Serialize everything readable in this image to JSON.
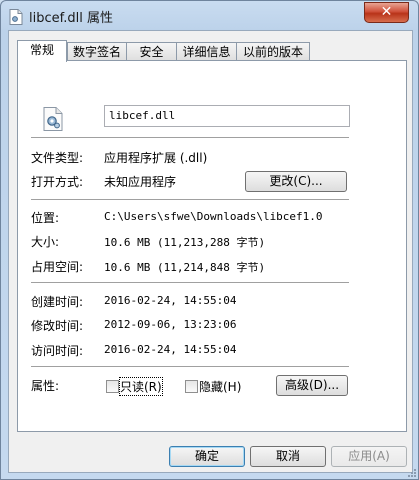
{
  "window": {
    "title": "libcef.dll 属性",
    "close_glyph": "✕"
  },
  "tabs": [
    {
      "label": "常规",
      "active": true
    },
    {
      "label": "数字签名",
      "active": false
    },
    {
      "label": "安全",
      "active": false
    },
    {
      "label": "详细信息",
      "active": false
    },
    {
      "label": "以前的版本",
      "active": false
    }
  ],
  "general": {
    "file_icon": "dll-file-gear-icon",
    "file_name": "libcef.dll",
    "file_type_label": "文件类型:",
    "file_type_value": "应用程序扩展 (.dll)",
    "opens_with_label": "打开方式:",
    "opens_with_value": "未知应用程序",
    "change_button": "更改(C)...",
    "location_label": "位置:",
    "location_value": "C:\\Users\\sfwe\\Downloads\\libcef1.0",
    "size_label": "大小:",
    "size_value": "10.6 MB (11,213,288 字节)",
    "size_on_disk_label": "占用空间:",
    "size_on_disk_value": "10.6 MB (11,214,848 字节)",
    "created_label": "创建时间:",
    "created_value": "2016-02-24, 14:55:04",
    "modified_label": "修改时间:",
    "modified_value": "2012-09-06, 13:23:06",
    "accessed_label": "访问时间:",
    "accessed_value": "2016-02-24, 14:55:04",
    "attributes_label": "属性:",
    "readonly_label": "只读(R)",
    "hidden_label": "隐藏(H)",
    "advanced_button": "高级(D)..."
  },
  "footer": {
    "ok_button": "确定",
    "cancel_button": "取消",
    "apply_button": "应用(A)"
  }
}
